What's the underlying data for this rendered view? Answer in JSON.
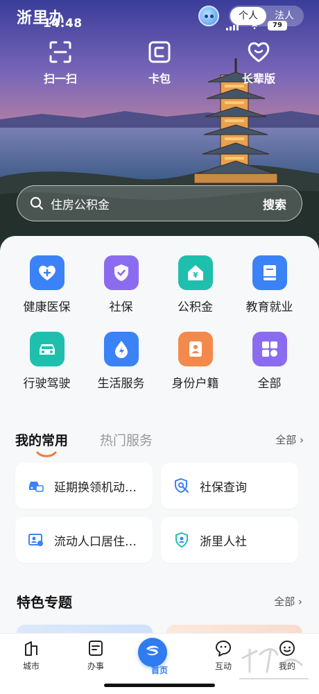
{
  "status_bar": {
    "app_logo": "浙里办",
    "time": "14:48",
    "battery": "79"
  },
  "mode_toggle": {
    "personal": "个人",
    "legal": "法人"
  },
  "quick_actions": [
    {
      "label": "扫一扫",
      "icon": "scan-icon"
    },
    {
      "label": "卡包",
      "icon": "card-wallet-icon"
    },
    {
      "label": "长辈版",
      "icon": "heart-smile-icon"
    }
  ],
  "search": {
    "placeholder": "住房公积金",
    "button": "搜索"
  },
  "services": [
    {
      "label": "健康医保",
      "icon": "heart-plus-icon",
      "color": "#3b82f6"
    },
    {
      "label": "社保",
      "icon": "shield-check-icon",
      "color": "#8b6cf0"
    },
    {
      "label": "公积金",
      "icon": "house-yuan-icon",
      "color": "#1fbfae"
    },
    {
      "label": "教育就业",
      "icon": "book-icon",
      "color": "#3b82f6"
    },
    {
      "label": "行驶驾驶",
      "icon": "car-icon",
      "color": "#1fbfae"
    },
    {
      "label": "生活服务",
      "icon": "drop-bolt-icon",
      "color": "#3b82f6"
    },
    {
      "label": "身份户籍",
      "icon": "id-badge-icon",
      "color": "#f38a4c"
    },
    {
      "label": "全部",
      "icon": "grid-icon",
      "color": "#8b6cf0"
    }
  ],
  "tabs": {
    "active": "我的常用",
    "inactive": "热门服务",
    "all": "全部 ›"
  },
  "frequent": [
    {
      "label": "延期换领机动…",
      "icon": "truck-id-icon"
    },
    {
      "label": "社保查询",
      "icon": "search-shield-icon"
    },
    {
      "label": "流动人口居住…",
      "icon": "resident-card-icon"
    },
    {
      "label": "浙里人社",
      "icon": "shield-person-icon"
    }
  ],
  "featured": {
    "title": "特色专题",
    "all": "全部 ›"
  },
  "bottom_nav": [
    {
      "label": "城市",
      "icon": "city-icon"
    },
    {
      "label": "办事",
      "icon": "task-icon"
    },
    {
      "label": "首页",
      "icon": "home-logo-icon"
    },
    {
      "label": "互动",
      "icon": "chat-face-icon"
    },
    {
      "label": "我的",
      "icon": "profile-face-icon"
    }
  ],
  "accent_color": "#2f7bf0"
}
